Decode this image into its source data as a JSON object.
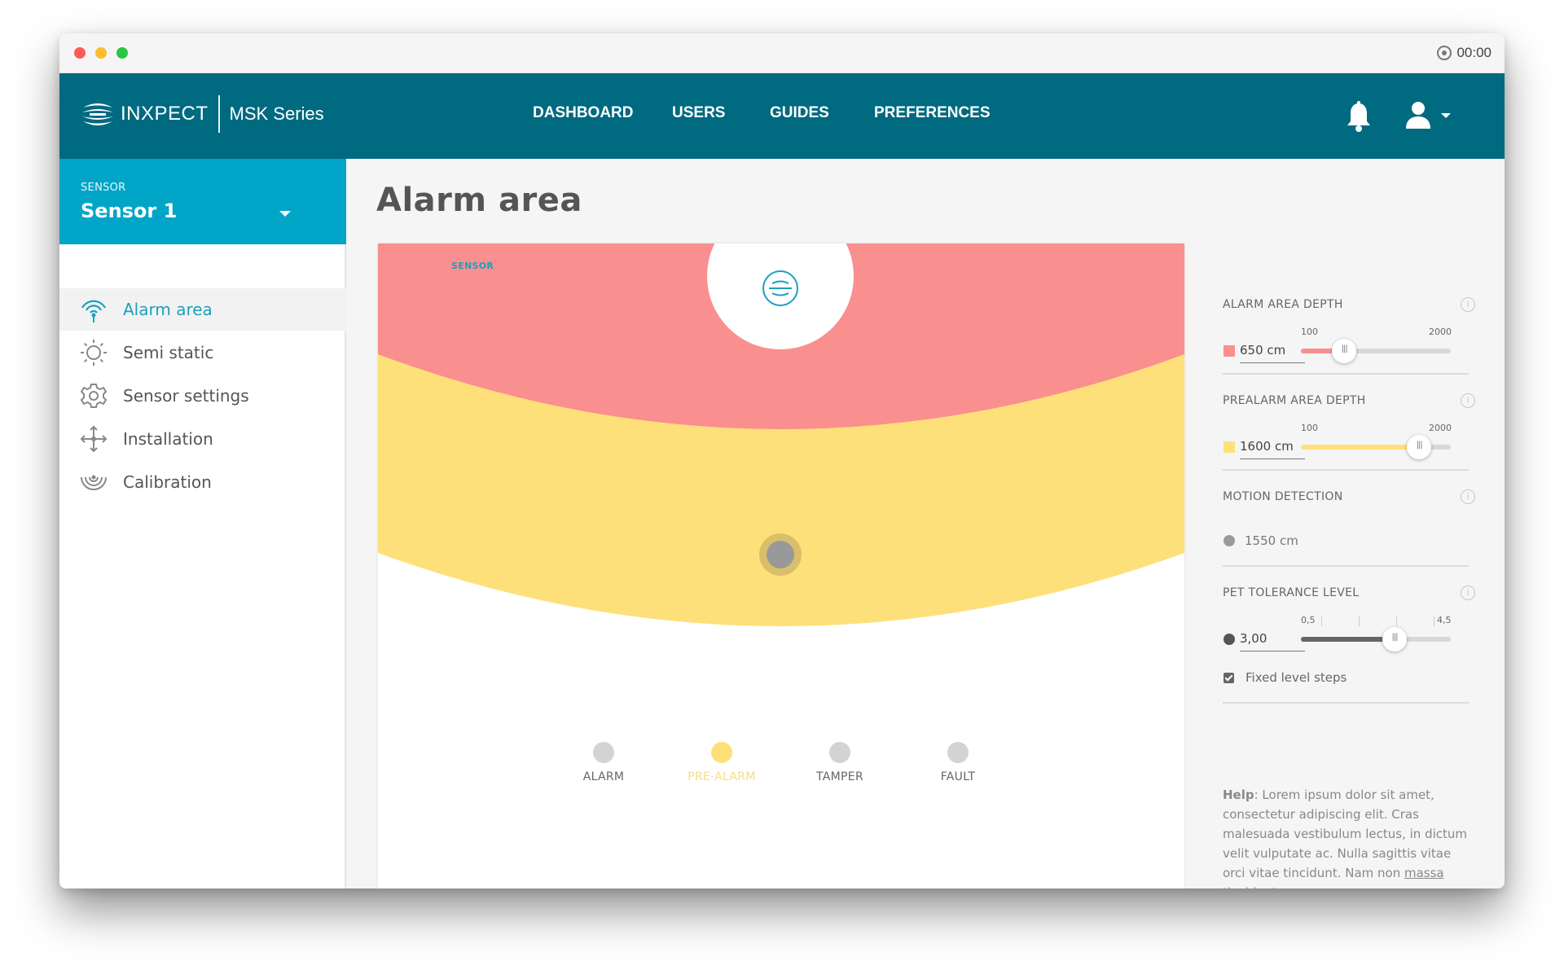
{
  "titlebar": {
    "time": "00:00"
  },
  "navbar": {
    "brand": "INXPECT",
    "series": "MSK Series",
    "links": [
      "DASHBOARD",
      "USERS",
      "GUIDES",
      "PREFERENCES"
    ]
  },
  "sidebar": {
    "sensor_label": "SENSOR",
    "sensor_name": "Sensor 1",
    "items": [
      {
        "label": "Alarm area",
        "icon": "alarm-area-icon",
        "active": true
      },
      {
        "label": "Semi static",
        "icon": "sun-icon",
        "active": false
      },
      {
        "label": "Sensor settings",
        "icon": "gear-icon",
        "active": false
      },
      {
        "label": "Installation",
        "icon": "move-arrows-icon",
        "active": false
      },
      {
        "label": "Calibration",
        "icon": "calibration-icon",
        "active": false
      }
    ]
  },
  "main": {
    "title": "Alarm area",
    "sensor_caption": "SENSOR",
    "legend": [
      "ALARM",
      "PRE-ALARM",
      "TAMPER",
      "FAULT"
    ],
    "active_legend": "PRE-ALARM"
  },
  "panel": {
    "alarm": {
      "title": "ALARM AREA DEPTH",
      "value": "650 cm",
      "min": "100",
      "max": "2000",
      "level": 650,
      "color": "#fa8f8f"
    },
    "prealarm": {
      "title": "PREALARM AREA DEPTH",
      "value": "1600 cm",
      "min": "100",
      "max": "2000",
      "level": 1600,
      "color": "#fee07a"
    },
    "motion": {
      "title": "MOTION DETECTION",
      "value": "1550 cm"
    },
    "pet": {
      "title": "PET TOLERANCE LEVEL",
      "value": "3,00",
      "min": "0,5",
      "max": "4,5",
      "level": 3.0
    },
    "fixed_steps": {
      "label": "Fixed level steps",
      "checked": true
    },
    "help": {
      "heading": "Help",
      "text": ": Lorem ipsum dolor sit amet, consectetur adipiscing elit. Cras malesuada vestibulum lectus, in dictum velit vulputate ac. Nulla sagittis vitae orci vitae tincidunt. Nam non ",
      "link": "massa tincidunt",
      "tail": ","
    }
  },
  "colors": {
    "navbar": "#006a80",
    "sensor_box": "#00a5c7",
    "accent": "#1d9fbd",
    "alarm": "#fa8f8f",
    "prealarm": "#fee07a"
  }
}
